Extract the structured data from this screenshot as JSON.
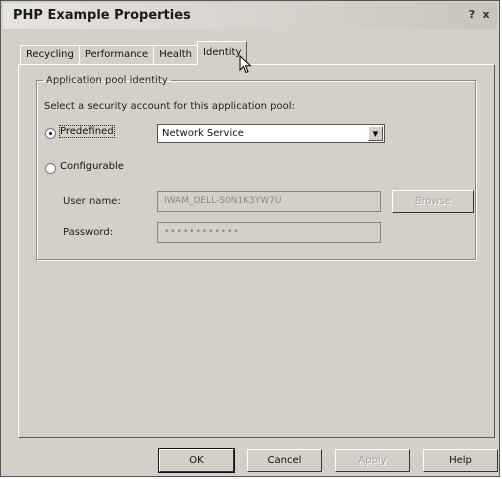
{
  "window": {
    "title": "PHP Example Properties",
    "help_glyph": "?",
    "close_glyph": "x"
  },
  "tabs": [
    {
      "label": "Recycling",
      "active": false
    },
    {
      "label": "Performance",
      "active": false
    },
    {
      "label": "Health",
      "active": false
    },
    {
      "label": "Identity",
      "active": true
    }
  ],
  "identity": {
    "group_label": "Application pool identity",
    "instruction": "Select a security account for this application pool:",
    "predefined": {
      "label": "Predefined",
      "checked": true
    },
    "account_select": {
      "value": "Network Service",
      "arrow": "▼"
    },
    "configurable": {
      "label": "Configurable",
      "checked": false
    },
    "user_name": {
      "label": "User name:",
      "value": "IWAM_DELL-S0N1K3YW7U"
    },
    "password": {
      "label": "Password:",
      "value": "••••••••••••"
    },
    "browse_label": "Browse"
  },
  "buttons": {
    "ok": "OK",
    "cancel": "Cancel",
    "apply": "Apply",
    "help": "Help"
  }
}
